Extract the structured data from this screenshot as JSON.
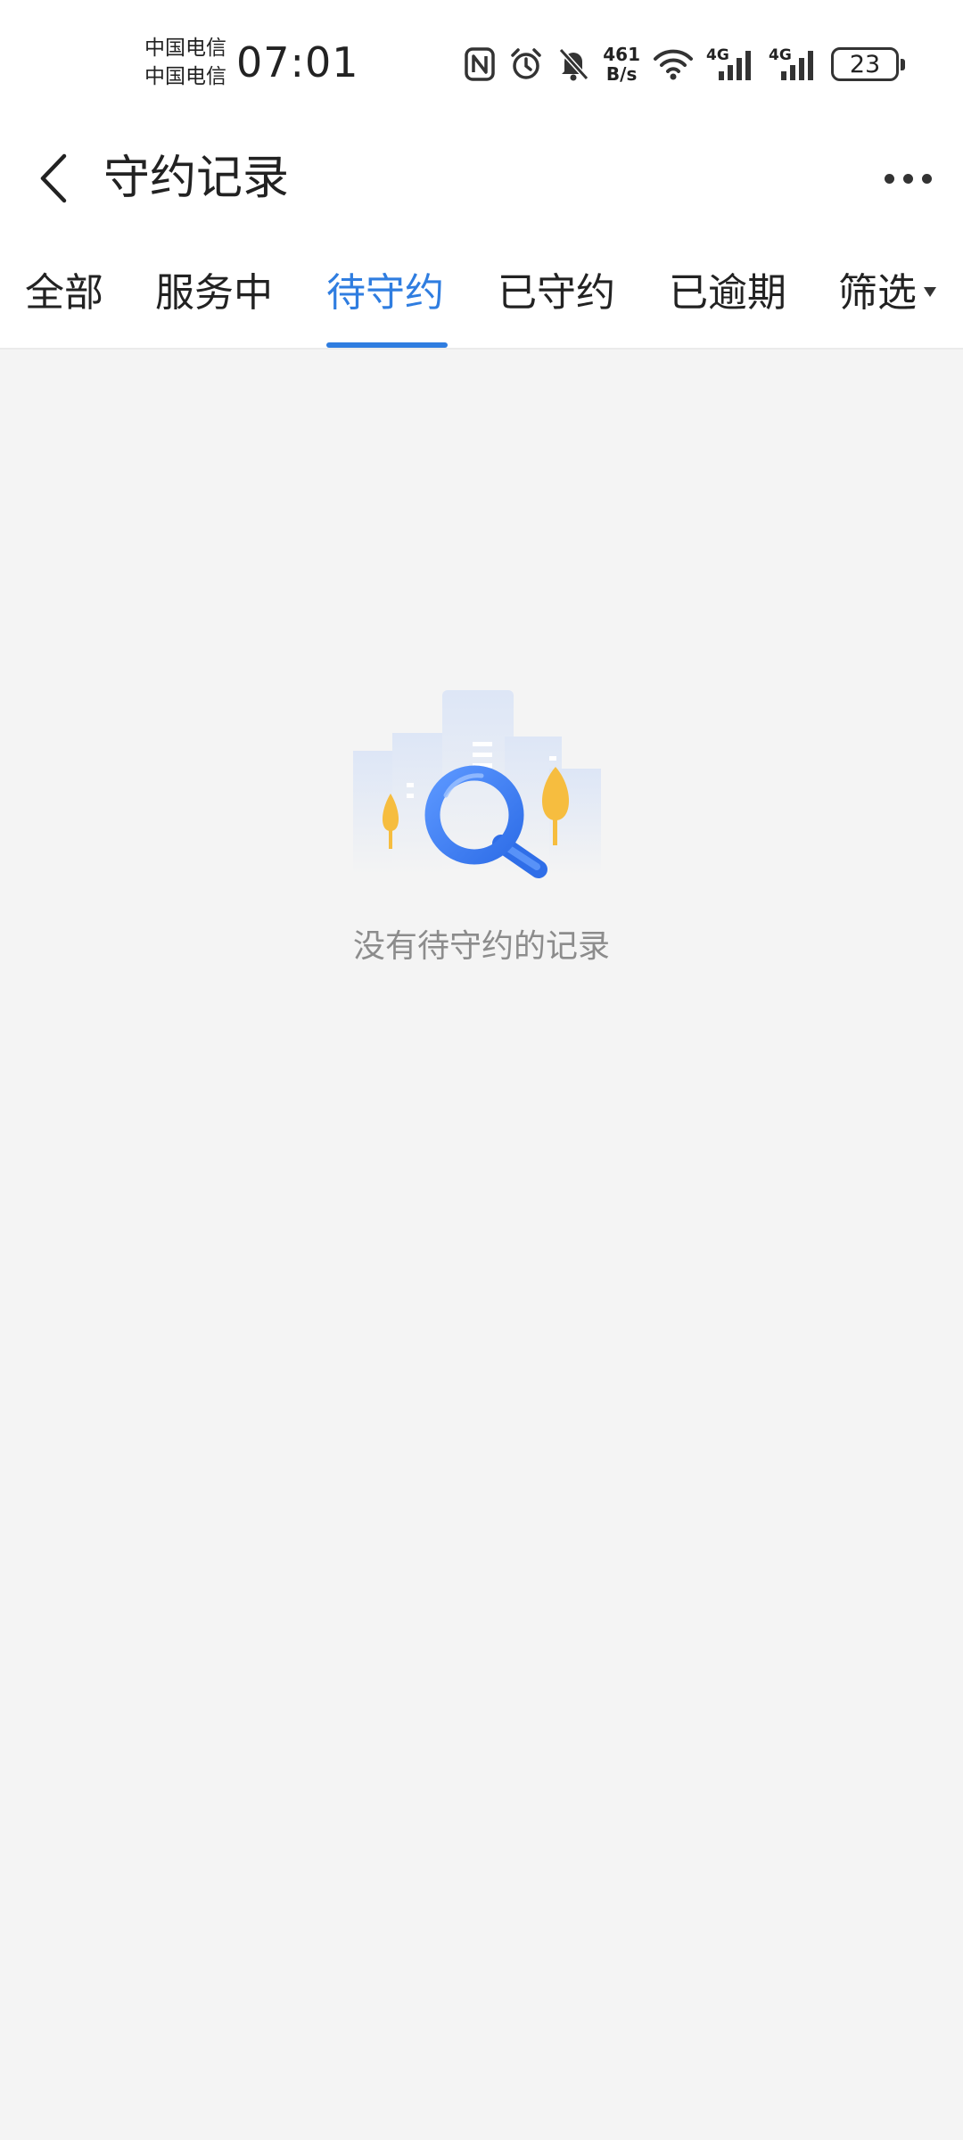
{
  "status_bar": {
    "carrier_1": "中国电信",
    "carrier_2": "中国电信",
    "time": "07:01",
    "net_speed_value": "461",
    "net_speed_unit": "B/s",
    "signal_1_label": "4G",
    "signal_2_label": "4G",
    "battery": "23",
    "icons": [
      "nfc-icon",
      "alarm-icon",
      "mute-icon",
      "wifi-icon",
      "signal-icon",
      "signal-icon",
      "battery-icon"
    ]
  },
  "header": {
    "title": "守约记录",
    "back_icon": "back-chevron-icon",
    "more_icon": "more-dots-icon"
  },
  "tabs": {
    "items": [
      {
        "label": "全部",
        "active": false
      },
      {
        "label": "服务中",
        "active": false
      },
      {
        "label": "待守约",
        "active": true
      },
      {
        "label": "已守约",
        "active": false
      },
      {
        "label": "已逾期",
        "active": false
      },
      {
        "label": "筛选",
        "active": false,
        "has_dropdown": true
      }
    ],
    "active_color": "#2f7de0"
  },
  "empty_state": {
    "icon": "empty-search-illustration",
    "text": "没有待守约的记录"
  },
  "colors": {
    "accent": "#2f7de0",
    "background": "#f4f4f4",
    "surface": "#ffffff",
    "muted_text": "#8c8c8c"
  }
}
